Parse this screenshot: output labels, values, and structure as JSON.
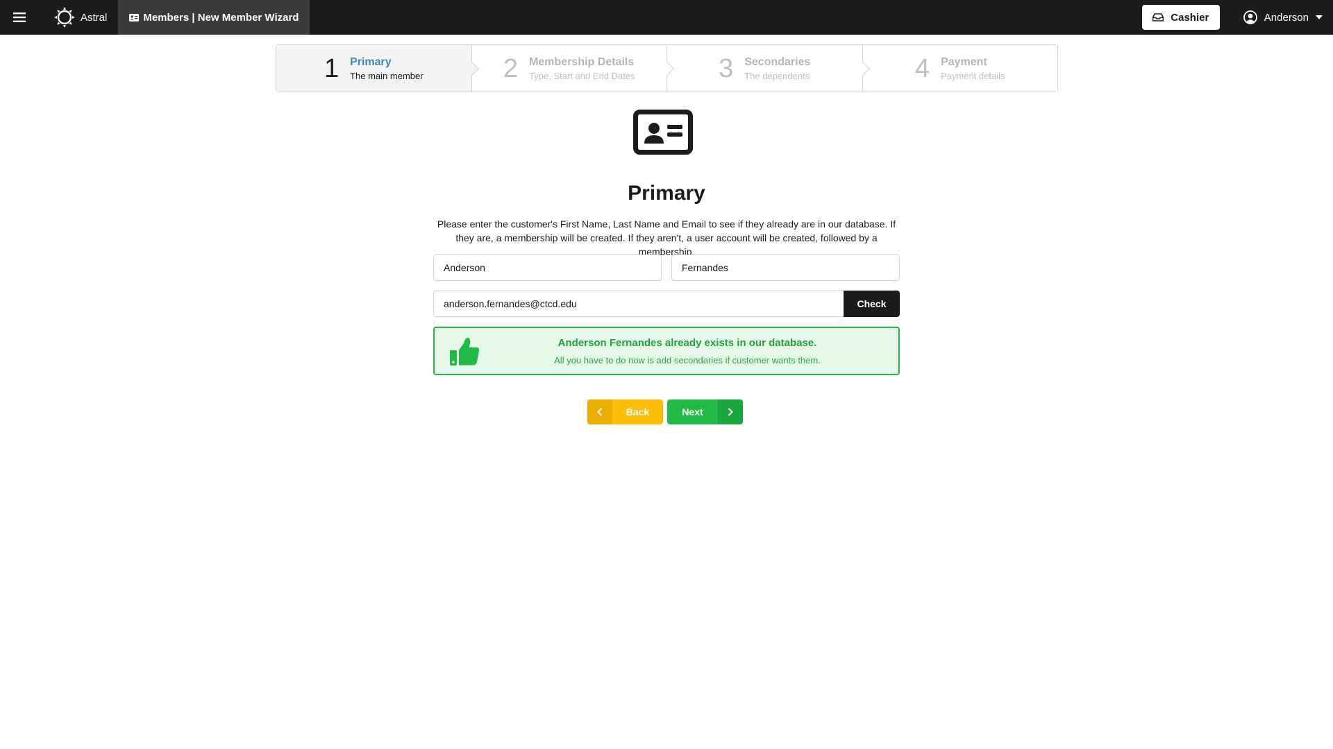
{
  "topbar": {
    "menu_icon": "hamburger-icon",
    "brand_icon": "sun-icon",
    "brand_label": "Astral",
    "tab_icon": "id-card-icon",
    "tab_label": "Members | New Member Wizard",
    "cashier_icon": "cash-drawer-icon",
    "cashier_label": "Cashier",
    "user_icon": "user-circle-icon",
    "user_label": "Anderson",
    "caret_icon": "caret-down-icon"
  },
  "steps": [
    {
      "number": "1",
      "title": "Primary",
      "description": "The main member",
      "active": true
    },
    {
      "number": "2",
      "title": "Membership Details",
      "description": "Type, Start and End Dates",
      "active": false
    },
    {
      "number": "3",
      "title": "Secondaries",
      "description": "The dependents",
      "active": false
    },
    {
      "number": "4",
      "title": "Payment",
      "description": "Payment details",
      "active": false
    }
  ],
  "main": {
    "header_icon": "address-card-icon",
    "title": "Primary",
    "instructions": "Please enter the customer's First Name, Last Name and Email to see if they already are in our database. If they are, a membership will be created. If they aren't, a user account will be created, followed by a membership.",
    "first_name_value": "Anderson",
    "last_name_value": "Fernandes",
    "email_value": "anderson.fernandes@ctcd.edu",
    "check_label": "Check"
  },
  "message": {
    "icon": "thumbs-up-icon",
    "headline": "Anderson Fernandes already exists in our database.",
    "subtext": "All you have to do now is add secondaries if customer wants them."
  },
  "nav": {
    "back_label": "Back",
    "back_icon": "chevron-left-icon",
    "next_label": "Next",
    "next_icon": "chevron-right-icon"
  },
  "colors": {
    "topbar": "#1b1c1d",
    "active_step_title": "#4183c4",
    "success": "#21ba45",
    "back": "#fbbd08",
    "next": "#21ba45"
  }
}
